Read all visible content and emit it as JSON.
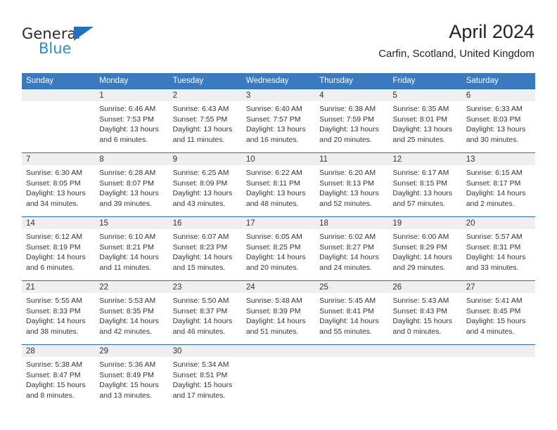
{
  "brand": {
    "name_top": "General",
    "name_bottom": "Blue",
    "triangle_color": "#1f6fc4",
    "blue_text_color": "#2e8bd8"
  },
  "header": {
    "title": "April 2024",
    "subtitle": "Carfin, Scotland, United Kingdom"
  },
  "theme": {
    "header_bar": "#3a7ac0",
    "week_separator": "#2b6cb5",
    "daynum_band": "#efefef",
    "text": "#333333"
  },
  "weekdays": [
    "Sunday",
    "Monday",
    "Tuesday",
    "Wednesday",
    "Thursday",
    "Friday",
    "Saturday"
  ],
  "weeks": [
    {
      "numbers": [
        "",
        "1",
        "2",
        "3",
        "4",
        "5",
        "6"
      ],
      "days": [
        {
          "sunrise": "",
          "sunset": "",
          "daylight_1": "",
          "daylight_2": ""
        },
        {
          "sunrise": "Sunrise: 6:46 AM",
          "sunset": "Sunset: 7:53 PM",
          "daylight_1": "Daylight: 13 hours",
          "daylight_2": "and 6 minutes."
        },
        {
          "sunrise": "Sunrise: 6:43 AM",
          "sunset": "Sunset: 7:55 PM",
          "daylight_1": "Daylight: 13 hours",
          "daylight_2": "and 11 minutes."
        },
        {
          "sunrise": "Sunrise: 6:40 AM",
          "sunset": "Sunset: 7:57 PM",
          "daylight_1": "Daylight: 13 hours",
          "daylight_2": "and 16 minutes."
        },
        {
          "sunrise": "Sunrise: 6:38 AM",
          "sunset": "Sunset: 7:59 PM",
          "daylight_1": "Daylight: 13 hours",
          "daylight_2": "and 20 minutes."
        },
        {
          "sunrise": "Sunrise: 6:35 AM",
          "sunset": "Sunset: 8:01 PM",
          "daylight_1": "Daylight: 13 hours",
          "daylight_2": "and 25 minutes."
        },
        {
          "sunrise": "Sunrise: 6:33 AM",
          "sunset": "Sunset: 8:03 PM",
          "daylight_1": "Daylight: 13 hours",
          "daylight_2": "and 30 minutes."
        }
      ]
    },
    {
      "numbers": [
        "7",
        "8",
        "9",
        "10",
        "11",
        "12",
        "13"
      ],
      "days": [
        {
          "sunrise": "Sunrise: 6:30 AM",
          "sunset": "Sunset: 8:05 PM",
          "daylight_1": "Daylight: 13 hours",
          "daylight_2": "and 34 minutes."
        },
        {
          "sunrise": "Sunrise: 6:28 AM",
          "sunset": "Sunset: 8:07 PM",
          "daylight_1": "Daylight: 13 hours",
          "daylight_2": "and 39 minutes."
        },
        {
          "sunrise": "Sunrise: 6:25 AM",
          "sunset": "Sunset: 8:09 PM",
          "daylight_1": "Daylight: 13 hours",
          "daylight_2": "and 43 minutes."
        },
        {
          "sunrise": "Sunrise: 6:22 AM",
          "sunset": "Sunset: 8:11 PM",
          "daylight_1": "Daylight: 13 hours",
          "daylight_2": "and 48 minutes."
        },
        {
          "sunrise": "Sunrise: 6:20 AM",
          "sunset": "Sunset: 8:13 PM",
          "daylight_1": "Daylight: 13 hours",
          "daylight_2": "and 52 minutes."
        },
        {
          "sunrise": "Sunrise: 6:17 AM",
          "sunset": "Sunset: 8:15 PM",
          "daylight_1": "Daylight: 13 hours",
          "daylight_2": "and 57 minutes."
        },
        {
          "sunrise": "Sunrise: 6:15 AM",
          "sunset": "Sunset: 8:17 PM",
          "daylight_1": "Daylight: 14 hours",
          "daylight_2": "and 2 minutes."
        }
      ]
    },
    {
      "numbers": [
        "14",
        "15",
        "16",
        "17",
        "18",
        "19",
        "20"
      ],
      "days": [
        {
          "sunrise": "Sunrise: 6:12 AM",
          "sunset": "Sunset: 8:19 PM",
          "daylight_1": "Daylight: 14 hours",
          "daylight_2": "and 6 minutes."
        },
        {
          "sunrise": "Sunrise: 6:10 AM",
          "sunset": "Sunset: 8:21 PM",
          "daylight_1": "Daylight: 14 hours",
          "daylight_2": "and 11 minutes."
        },
        {
          "sunrise": "Sunrise: 6:07 AM",
          "sunset": "Sunset: 8:23 PM",
          "daylight_1": "Daylight: 14 hours",
          "daylight_2": "and 15 minutes."
        },
        {
          "sunrise": "Sunrise: 6:05 AM",
          "sunset": "Sunset: 8:25 PM",
          "daylight_1": "Daylight: 14 hours",
          "daylight_2": "and 20 minutes."
        },
        {
          "sunrise": "Sunrise: 6:02 AM",
          "sunset": "Sunset: 8:27 PM",
          "daylight_1": "Daylight: 14 hours",
          "daylight_2": "and 24 minutes."
        },
        {
          "sunrise": "Sunrise: 6:00 AM",
          "sunset": "Sunset: 8:29 PM",
          "daylight_1": "Daylight: 14 hours",
          "daylight_2": "and 29 minutes."
        },
        {
          "sunrise": "Sunrise: 5:57 AM",
          "sunset": "Sunset: 8:31 PM",
          "daylight_1": "Daylight: 14 hours",
          "daylight_2": "and 33 minutes."
        }
      ]
    },
    {
      "numbers": [
        "21",
        "22",
        "23",
        "24",
        "25",
        "26",
        "27"
      ],
      "days": [
        {
          "sunrise": "Sunrise: 5:55 AM",
          "sunset": "Sunset: 8:33 PM",
          "daylight_1": "Daylight: 14 hours",
          "daylight_2": "and 38 minutes."
        },
        {
          "sunrise": "Sunrise: 5:53 AM",
          "sunset": "Sunset: 8:35 PM",
          "daylight_1": "Daylight: 14 hours",
          "daylight_2": "and 42 minutes."
        },
        {
          "sunrise": "Sunrise: 5:50 AM",
          "sunset": "Sunset: 8:37 PM",
          "daylight_1": "Daylight: 14 hours",
          "daylight_2": "and 46 minutes."
        },
        {
          "sunrise": "Sunrise: 5:48 AM",
          "sunset": "Sunset: 8:39 PM",
          "daylight_1": "Daylight: 14 hours",
          "daylight_2": "and 51 minutes."
        },
        {
          "sunrise": "Sunrise: 5:45 AM",
          "sunset": "Sunset: 8:41 PM",
          "daylight_1": "Daylight: 14 hours",
          "daylight_2": "and 55 minutes."
        },
        {
          "sunrise": "Sunrise: 5:43 AM",
          "sunset": "Sunset: 8:43 PM",
          "daylight_1": "Daylight: 15 hours",
          "daylight_2": "and 0 minutes."
        },
        {
          "sunrise": "Sunrise: 5:41 AM",
          "sunset": "Sunset: 8:45 PM",
          "daylight_1": "Daylight: 15 hours",
          "daylight_2": "and 4 minutes."
        }
      ]
    },
    {
      "numbers": [
        "28",
        "29",
        "30",
        "",
        "",
        "",
        ""
      ],
      "days": [
        {
          "sunrise": "Sunrise: 5:38 AM",
          "sunset": "Sunset: 8:47 PM",
          "daylight_1": "Daylight: 15 hours",
          "daylight_2": "and 8 minutes."
        },
        {
          "sunrise": "Sunrise: 5:36 AM",
          "sunset": "Sunset: 8:49 PM",
          "daylight_1": "Daylight: 15 hours",
          "daylight_2": "and 13 minutes."
        },
        {
          "sunrise": "Sunrise: 5:34 AM",
          "sunset": "Sunset: 8:51 PM",
          "daylight_1": "Daylight: 15 hours",
          "daylight_2": "and 17 minutes."
        },
        {
          "sunrise": "",
          "sunset": "",
          "daylight_1": "",
          "daylight_2": ""
        },
        {
          "sunrise": "",
          "sunset": "",
          "daylight_1": "",
          "daylight_2": ""
        },
        {
          "sunrise": "",
          "sunset": "",
          "daylight_1": "",
          "daylight_2": ""
        },
        {
          "sunrise": "",
          "sunset": "",
          "daylight_1": "",
          "daylight_2": ""
        }
      ]
    }
  ]
}
